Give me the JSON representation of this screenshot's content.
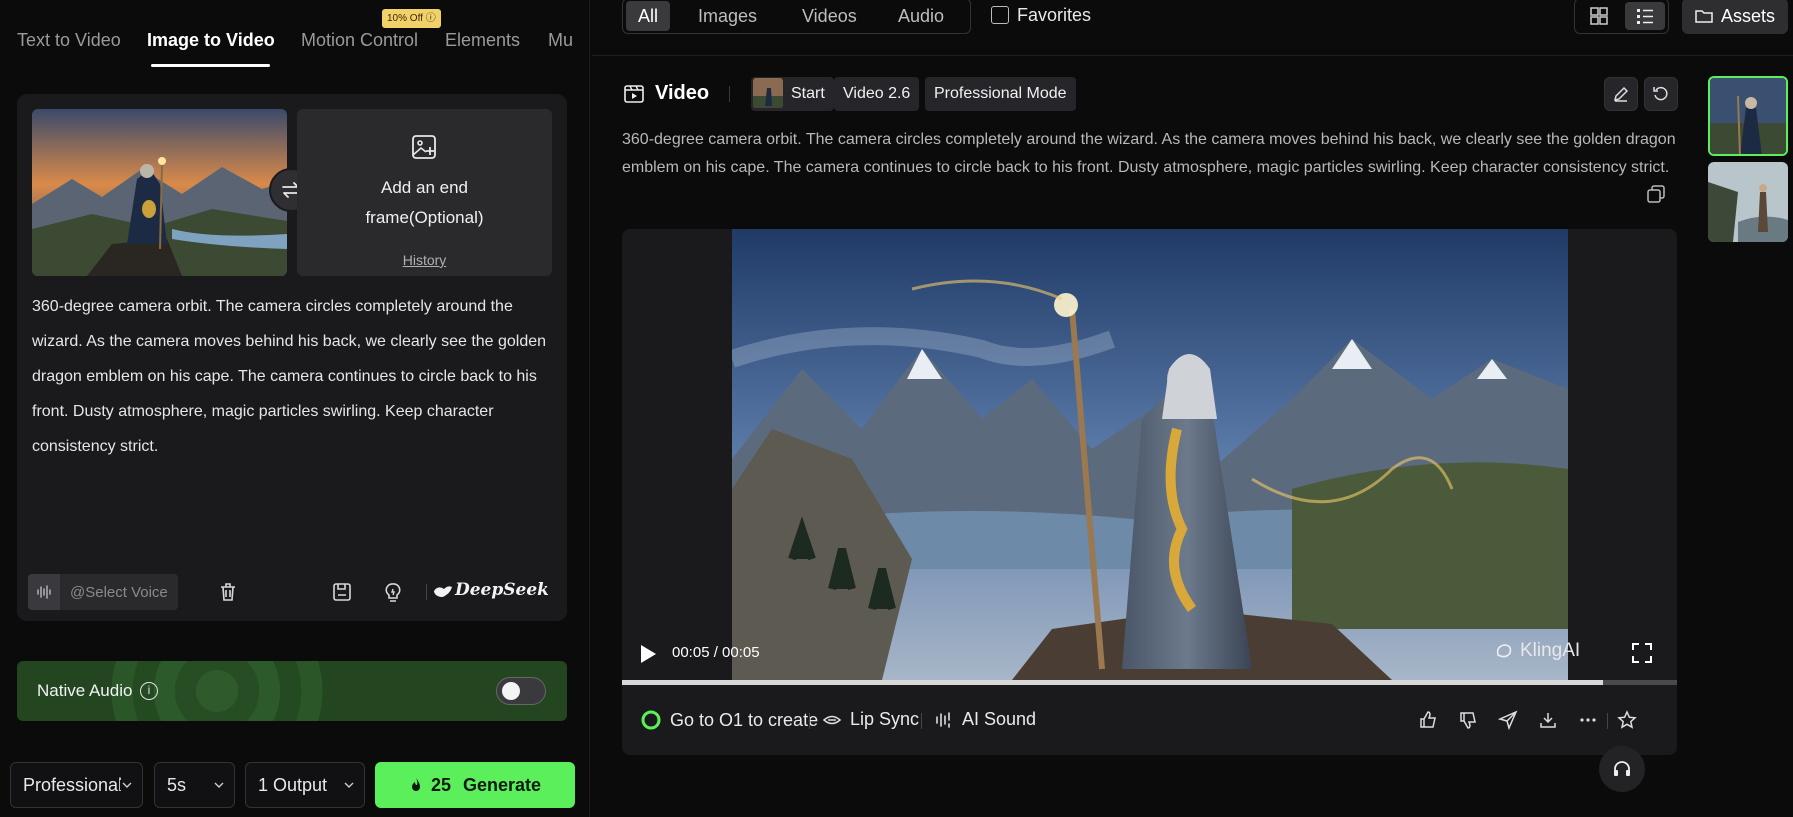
{
  "tabs": {
    "items": [
      "Text to Video",
      "Image to Video",
      "Motion Control",
      "Elements",
      "Mu"
    ],
    "active": "Image to Video",
    "promo_badge": "10% Off ⓘ"
  },
  "frames": {
    "end_title": "Add an end frame(Optional)",
    "history": "History"
  },
  "prompt": {
    "text": "360-degree camera orbit. The camera circles completely around the wizard. As the camera moves behind his back, we clearly see the golden dragon emblem on his cape.   The camera continues to circle back to his front. Dusty atmosphere, magic particles swirling. Keep character consistency strict.",
    "voice_placeholder": "@Select Voice",
    "deepseek_label": "DeepSeek"
  },
  "native_audio": {
    "label": "Native Audio",
    "info": "i",
    "enabled": false
  },
  "bottom": {
    "mode": "Professional",
    "duration": "5s",
    "outputs": "1 Output",
    "credits": "25",
    "generate_label": "Generate"
  },
  "filters": {
    "items": [
      "All",
      "Images",
      "Videos",
      "Audio"
    ],
    "active": "All",
    "favorites": "Favorites",
    "assets": "Assets"
  },
  "video": {
    "title": "Video",
    "chips": [
      "Start",
      "Video 2.6",
      "Professional Mode"
    ],
    "description": "360-degree camera orbit. The camera circles completely around the wizard. As the camera moves behind his back, we clearly see the golden dragon emblem on his cape. The camera continues to circle back to his front. Dusty atmosphere, magic particles swirling. Keep character consistency strict.",
    "time": "00:05 / 00:05",
    "watermark": "KlingAI",
    "progress_fraction": 0.93
  },
  "actions": {
    "o1": "Go to O1 to create",
    "lip_sync": "Lip Sync",
    "ai_sound": "AI Sound"
  },
  "colors": {
    "accent": "#5bf05b",
    "panel": "#1a1a1c",
    "background": "#0b0b0c"
  }
}
